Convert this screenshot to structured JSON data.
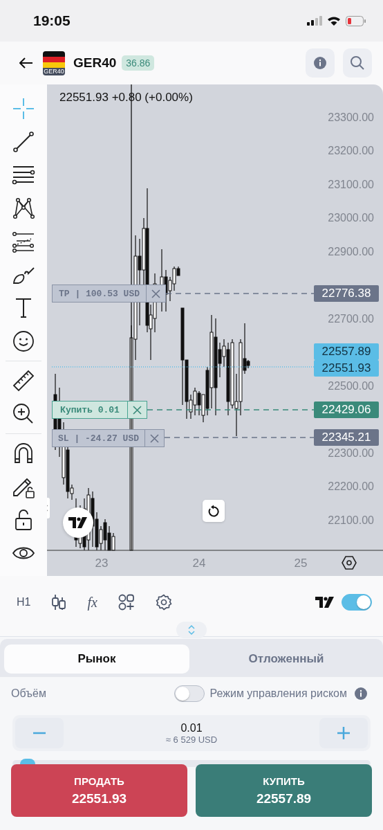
{
  "status_bar": {
    "time": "19:05"
  },
  "header": {
    "flag_label": "GER40",
    "symbol": "GER40",
    "spread": "36.86"
  },
  "chart": {
    "legend": "22551.93 +0.80 (+0.00%)",
    "price_ticks": [
      "23300.00",
      "23200.00",
      "23100.00",
      "23000.00",
      "22900.00",
      "22700.00",
      "22500.00",
      "22300.00",
      "22200.00",
      "22100.00"
    ],
    "time_ticks": [
      "23",
      "24",
      "25"
    ],
    "price_tags": [
      {
        "kind": "order",
        "text": "22776.38"
      },
      {
        "kind": "ask",
        "text": "22557.89"
      },
      {
        "kind": "bid",
        "text": "22551.93"
      },
      {
        "kind": "entry",
        "text": "22429.06"
      },
      {
        "kind": "order",
        "text": "22345.21"
      }
    ],
    "orders": [
      {
        "kind": "tp",
        "label": "TP | 100.53 USD"
      },
      {
        "kind": "entry",
        "label": "Купить 0.01"
      },
      {
        "kind": "sl",
        "label": "SL | -24.27 USD"
      }
    ]
  },
  "toolbar": {
    "timeframe": "H1",
    "indicators": "fx",
    "chart_toggle": {
      "on": true
    }
  },
  "order_tabs": [
    {
      "label": "Рынок",
      "selected": true
    },
    {
      "label": "Отложенный",
      "selected": false
    }
  ],
  "volume": {
    "label": "Объём",
    "risk_mode": {
      "label": "Режим управления риском",
      "on": false
    },
    "value": "0.01",
    "approx": "≈ 6 529 USD",
    "risk_slider": {
      "level": 0.01
    }
  },
  "actions": [
    {
      "kind": "sell",
      "label": "ПРОДАТЬ",
      "price": "22551.93"
    },
    {
      "kind": "buy",
      "label": "КУПИТЬ",
      "price": "22557.89"
    }
  ]
}
